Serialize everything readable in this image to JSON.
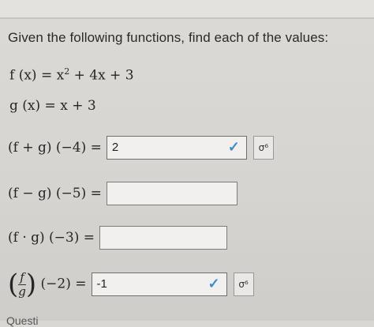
{
  "question": "Given the following functions, find each of the values:",
  "functions": {
    "f_lhs": "f (x) =",
    "f_rhs_base": "x",
    "f_rhs_exp": "2",
    "f_rhs_rest": " + 4x + 3",
    "g_lhs": "g (x) =",
    "g_rhs": "x + 3"
  },
  "items": [
    {
      "label": "(f + g) (−4) =",
      "answer": "2",
      "checked": true
    },
    {
      "label": "(f − g) (−5) =",
      "answer": "",
      "checked": false
    },
    {
      "label": "(f · g) (−3) =",
      "answer": "",
      "checked": false
    },
    {
      "label_num": "f",
      "label_den": "g",
      "label_rest": "(−2) =",
      "answer": "-1",
      "checked": true
    }
  ],
  "icons": {
    "check": "check-icon",
    "key": "key-icon"
  },
  "glyphs": {
    "check": "✓",
    "key": "σ⁶"
  },
  "footer_partial": "Questi"
}
